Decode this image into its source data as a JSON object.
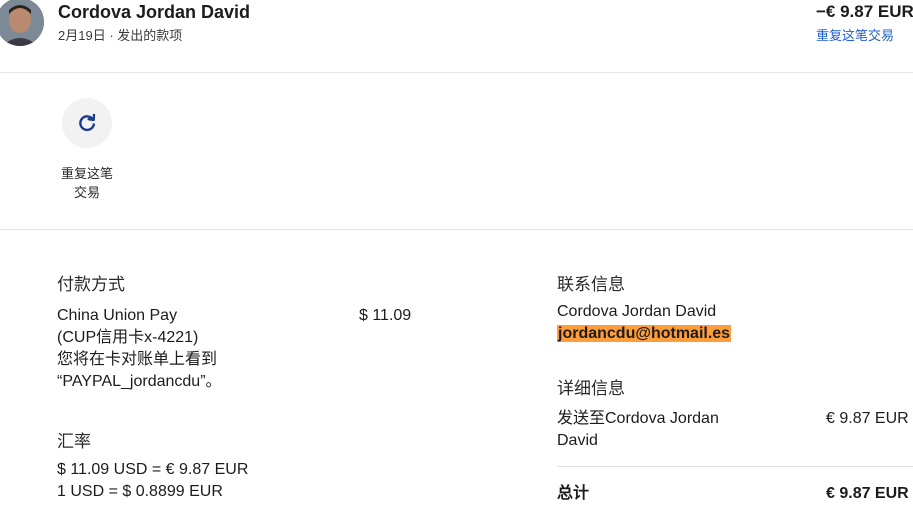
{
  "header": {
    "contact_name": "Cordova Jordan David",
    "date": "2月19日",
    "separator": "·",
    "type": "发出的款项",
    "amount": "−€ 9.87 EUR",
    "repeat_link": "重复这笔交易"
  },
  "actions": {
    "repeat_icon": "refresh-icon",
    "repeat_label_line1": "重复这笔",
    "repeat_label_line2": "交易"
  },
  "payment": {
    "title": "付款方式",
    "method_line1": "China Union Pay",
    "method_line2": "(CUP信用卡x-4221)",
    "note_line1": "您将在卡对账单上看到",
    "note_line2": "“PAYPAL_jordancdu”。",
    "amount": "$ 11.09"
  },
  "exchange": {
    "title": "汇率",
    "line1": "$ 11.09 USD = € 9.87 EUR",
    "line2": "1 USD = $ 0.8899 EUR"
  },
  "contact": {
    "title": "联系信息",
    "name": "Cordova Jordan David",
    "email": "jordancdu@hotmail.es",
    "highlight_color": "#ff9d3b"
  },
  "details": {
    "title": "详细信息",
    "sent_to_line1": "发送至Cordova Jordan",
    "sent_to_line2": "David",
    "sent_amount": "€ 9.87 EUR",
    "total_label": "总计",
    "total_amount": "€ 9.87 EUR"
  },
  "colors": {
    "link": "#1f5fcf",
    "text": "#1c1c1c"
  }
}
